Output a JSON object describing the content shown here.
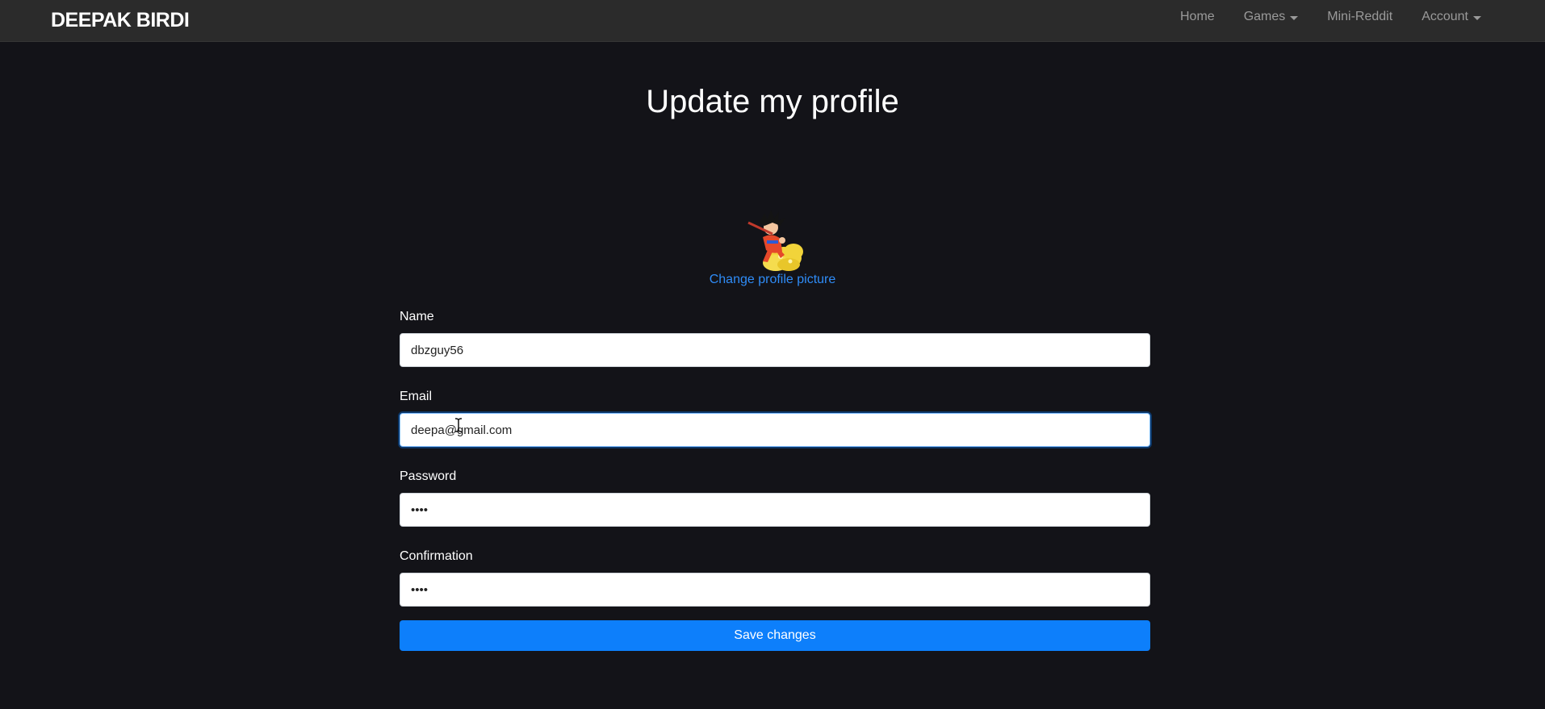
{
  "nav": {
    "brand": "DEEPAK BIRDI",
    "links": [
      {
        "label": "Home",
        "dropdown": false
      },
      {
        "label": "Games",
        "dropdown": true
      },
      {
        "label": "Mini-Reddit",
        "dropdown": false
      },
      {
        "label": "Account",
        "dropdown": true
      }
    ]
  },
  "page": {
    "title": "Update my profile",
    "change_picture": "Change profile picture"
  },
  "form": {
    "name_label": "Name",
    "name_value": "dbzguy56",
    "email_label": "Email",
    "email_value": "deepa@gmail.com",
    "password_label": "Password",
    "password_value": "abcd",
    "confirmation_label": "Confirmation",
    "confirmation_value": "abcd",
    "save_label": "Save changes"
  },
  "colors": {
    "background": "#131318",
    "navbar": "#2b2b2b",
    "accent": "#0d7ffb",
    "link": "#2f8cf7"
  },
  "icons": {
    "avatar": "goku-on-cloud-avatar",
    "cursor": "text-cursor-icon"
  }
}
